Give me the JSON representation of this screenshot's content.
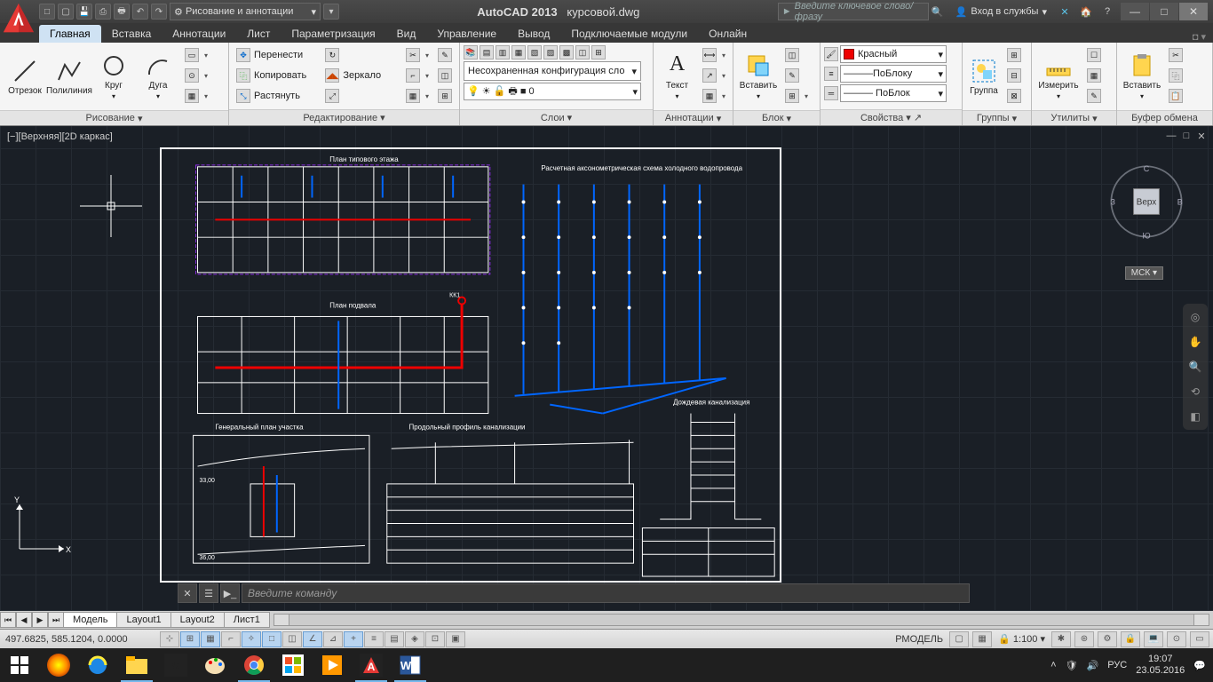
{
  "app": {
    "name": "AutoCAD 2013",
    "file": "курсовой.dwg"
  },
  "qat_workspace": "Рисование и аннотации",
  "search_placeholder": "Введите ключевое слово/фразу",
  "login_label": "Вход в службы",
  "tabs": [
    "Главная",
    "Вставка",
    "Аннотации",
    "Лист",
    "Параметризация",
    "Вид",
    "Управление",
    "Вывод",
    "Подключаемые модули",
    "Онлайн"
  ],
  "panels": {
    "draw": {
      "title": "Рисование",
      "items": [
        "Отрезок",
        "Полилиния",
        "Круг",
        "Дуга"
      ]
    },
    "modify": {
      "title": "Редактирование",
      "items": [
        "Перенести",
        "Копировать",
        "Растянуть",
        "Зеркало"
      ]
    },
    "layers": {
      "title": "Слои",
      "config": "Несохраненная конфигурация сло",
      "current": "0"
    },
    "annot": {
      "title": "Аннотации",
      "text": "Текст"
    },
    "block": {
      "title": "Блок",
      "insert": "Вставить"
    },
    "props": {
      "title": "Свойства",
      "color": "Красный",
      "lw": "———ПоБлоку",
      "lt": "——— ПоБлок"
    },
    "groups": {
      "title": "Группы",
      "btn": "Группа"
    },
    "utils": {
      "title": "Утилиты",
      "btn": "Измерить"
    },
    "clip": {
      "title": "Буфер обмена",
      "btn": "Вставить"
    }
  },
  "viewport_label": "[−][Верхняя][2D каркас]",
  "viewcube": {
    "top": "Верх",
    "n": "С",
    "s": "Ю",
    "e": "В",
    "w": "З",
    "wcs": "МСК"
  },
  "drawing_titles": {
    "t1": "План типового этажа",
    "t2": "Расчетная аксонометрическая схема холодного водопровода",
    "t3": "План подвала",
    "t4": "Генеральный план участка",
    "t5": "Продольный профиль канализации",
    "t6": "Дождевая канализация"
  },
  "cmd_placeholder": "Введите команду",
  "layout_tabs": [
    "Модель",
    "Layout1",
    "Layout2",
    "Лист1"
  ],
  "status": {
    "coords": "497.6825, 585.1204, 0.0000",
    "model": "РМОДЕЛЬ",
    "scale": "1:100",
    "lang": "РУС",
    "time": "19:07",
    "date": "23.05.2016"
  }
}
